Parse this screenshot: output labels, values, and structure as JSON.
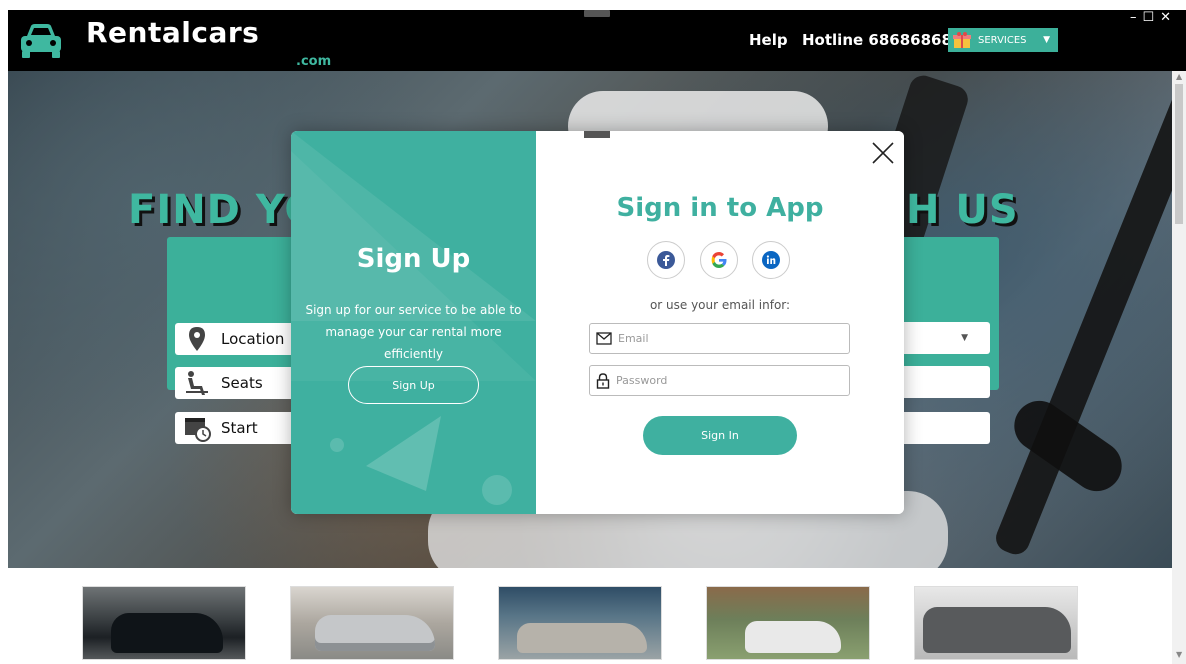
{
  "header": {
    "brand": "Rentalcars",
    "brand_suffix": ".com",
    "help": "Help",
    "hotline": "Hotline 68686868",
    "services": "SERVICES",
    "window_controls": {
      "minimize": "–",
      "maximize": "☐",
      "close": "✕"
    }
  },
  "hero": {
    "title_left": "FIND YO",
    "title_right": "H US"
  },
  "search": {
    "location": "Location",
    "seats": "Seats",
    "start": "Start"
  },
  "modal": {
    "signup": {
      "title": "Sign Up",
      "description": "Sign up for our service to be able to manage your car rental more efficiently",
      "button": "Sign Up"
    },
    "signin": {
      "title": "Sign in to App",
      "or_text": "or use your email infor:",
      "email_placeholder": "Email",
      "password_placeholder": "Password",
      "button": "Sign In"
    }
  },
  "colors": {
    "accent": "#3fb0a0",
    "header_bg": "#000000",
    "facebook": "#3b5998",
    "linkedin": "#0a66c2"
  },
  "icons": {
    "logo": "car-icon",
    "phone": "phone-icon",
    "services": "gift-icon",
    "location": "map-pin-icon",
    "seats": "seat-icon",
    "start": "calendar-clock-icon",
    "email": "envelope-icon",
    "password": "lock-icon",
    "close": "close-icon",
    "social": [
      "facebook-icon",
      "google-icon",
      "linkedin-icon"
    ]
  }
}
